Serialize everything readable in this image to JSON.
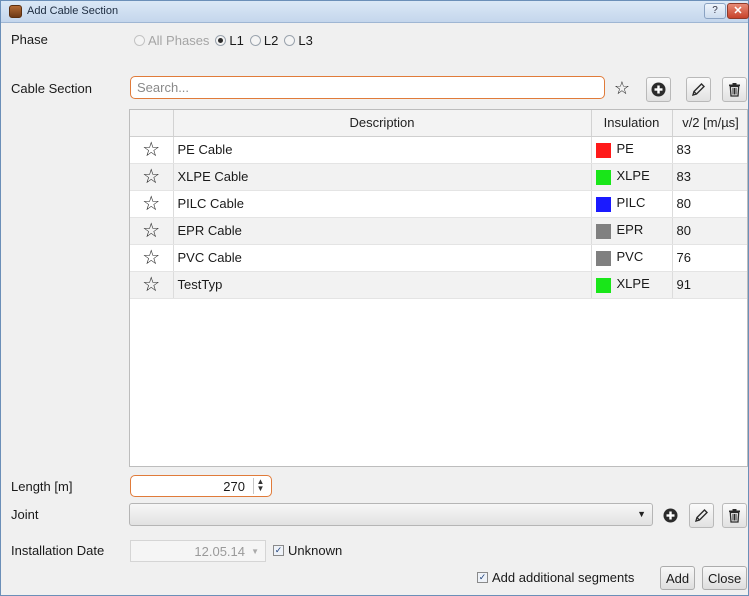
{
  "window": {
    "title": "Add Cable Section",
    "help_label": "?",
    "close_label": "✕"
  },
  "phase": {
    "label": "Phase",
    "options": [
      {
        "label": "All Phases",
        "checked": false,
        "disabled": true
      },
      {
        "label": "L1",
        "checked": true,
        "disabled": false
      },
      {
        "label": "L2",
        "checked": false,
        "disabled": false
      },
      {
        "label": "L3",
        "checked": false,
        "disabled": false
      }
    ]
  },
  "cable_section": {
    "label": "Cable Section",
    "search_placeholder": "Search...",
    "search_value": "",
    "favorite_icon": "☆",
    "add_icon": "plus-circle-icon",
    "edit_icon": "pencil-icon",
    "delete_icon": "trash-icon"
  },
  "table": {
    "headers": [
      "",
      "Description",
      "Insulation",
      "v/2 [m/µs]"
    ],
    "rows": [
      {
        "star": "☆",
        "description": "PE Cable",
        "insulation": "PE",
        "color": "#ff1a1a",
        "v2": "83"
      },
      {
        "star": "☆",
        "description": "XLPE Cable",
        "insulation": "XLPE",
        "color": "#19e619",
        "v2": "83"
      },
      {
        "star": "☆",
        "description": "PILC Cable",
        "insulation": "PILC",
        "color": "#1a1aff",
        "v2": "80"
      },
      {
        "star": "☆",
        "description": "EPR Cable",
        "insulation": "EPR",
        "color": "#808080",
        "v2": "80"
      },
      {
        "star": "☆",
        "description": "PVC Cable",
        "insulation": "PVC",
        "color": "#808080",
        "v2": "76"
      },
      {
        "star": "☆",
        "description": "TestTyp",
        "insulation": "XLPE",
        "color": "#19e619",
        "v2": "91"
      }
    ]
  },
  "length": {
    "label": "Length [m]",
    "value": "270"
  },
  "joint": {
    "label": "Joint",
    "selected": ""
  },
  "installation": {
    "label": "Installation Date",
    "date": "12.05.14",
    "unknown_label": "Unknown",
    "unknown_checked": true
  },
  "footer": {
    "add_segments_label": "Add additional segments",
    "add_segments_checked": true,
    "add_label": "Add",
    "close_label": "Close"
  }
}
